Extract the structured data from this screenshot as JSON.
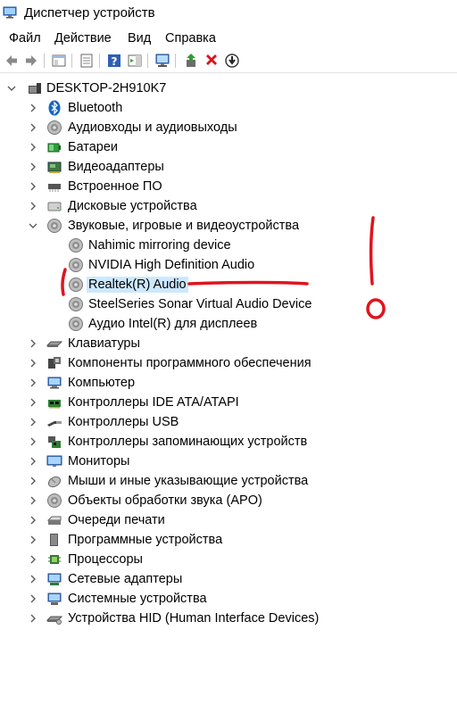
{
  "window": {
    "title": "Диспетчер устройств"
  },
  "menu": [
    "Файл",
    "Действие",
    "Вид",
    "Справка"
  ],
  "toolbar": {
    "buttons": [
      {
        "icon": "back-arrow-icon"
      },
      {
        "icon": "forward-arrow-icon"
      },
      {
        "icon": "show-hide-console-tree-icon"
      },
      {
        "icon": "properties-icon"
      },
      {
        "icon": "help-icon"
      },
      {
        "icon": "action-pane-icon"
      },
      {
        "icon": "scan-hardware-icon"
      },
      {
        "icon": "update-driver-icon"
      },
      {
        "icon": "uninstall-device-icon"
      },
      {
        "icon": "disable-device-icon"
      }
    ]
  },
  "tree": {
    "root": "DESKTOP-2H910K7",
    "categories": [
      {
        "label": "Bluetooth",
        "icon": "bluetooth-icon"
      },
      {
        "label": "Аудиовходы и аудиовыходы",
        "icon": "speaker-icon"
      },
      {
        "label": "Батареи",
        "icon": "battery-icon"
      },
      {
        "label": "Видеоадаптеры",
        "icon": "display-adapter-icon"
      },
      {
        "label": "Встроенное ПО",
        "icon": "firmware-icon"
      },
      {
        "label": "Дисковые устройства",
        "icon": "disk-drive-icon"
      },
      {
        "label": "Звуковые, игровые и видеоустройства",
        "icon": "speaker-icon",
        "expanded": true
      },
      {
        "label": "Клавиатуры",
        "icon": "keyboard-icon"
      },
      {
        "label": "Компоненты программного обеспечения",
        "icon": "software-component-icon"
      },
      {
        "label": "Компьютер",
        "icon": "computer-icon"
      },
      {
        "label": "Контроллеры IDE ATA/ATAPI",
        "icon": "ide-controller-icon"
      },
      {
        "label": "Контроллеры USB",
        "icon": "usb-icon"
      },
      {
        "label": "Контроллеры запоминающих устройств",
        "icon": "storage-controller-icon"
      },
      {
        "label": "Мониторы",
        "icon": "monitor-icon"
      },
      {
        "label": "Мыши и иные указывающие устройства",
        "icon": "mouse-icon"
      },
      {
        "label": "Объекты обработки звука (APO)",
        "icon": "speaker-icon"
      },
      {
        "label": "Очереди печати",
        "icon": "printer-icon"
      },
      {
        "label": "Программные устройства",
        "icon": "software-device-icon"
      },
      {
        "label": "Процессоры",
        "icon": "processor-icon"
      },
      {
        "label": "Сетевые адаптеры",
        "icon": "network-adapter-icon"
      },
      {
        "label": "Системные устройства",
        "icon": "system-device-icon"
      },
      {
        "label": "Устройства HID (Human Interface Devices)",
        "icon": "hid-icon"
      }
    ],
    "sound_children": [
      {
        "label": "Nahimic mirroring device",
        "icon": "speaker-icon"
      },
      {
        "label": "NVIDIA High Definition Audio",
        "icon": "speaker-icon"
      },
      {
        "label": "Realtek(R) Audio",
        "icon": "speaker-icon",
        "selected": true
      },
      {
        "label": "SteelSeries Sonar Virtual Audio Device",
        "icon": "speaker-icon"
      },
      {
        "label": "Аудио Intel(R) для дисплеев",
        "icon": "speaker-icon"
      }
    ]
  },
  "colors": {
    "selection": "#cce8ff",
    "annotation_red": "#e0141e",
    "expander": "#5a5a5a"
  }
}
